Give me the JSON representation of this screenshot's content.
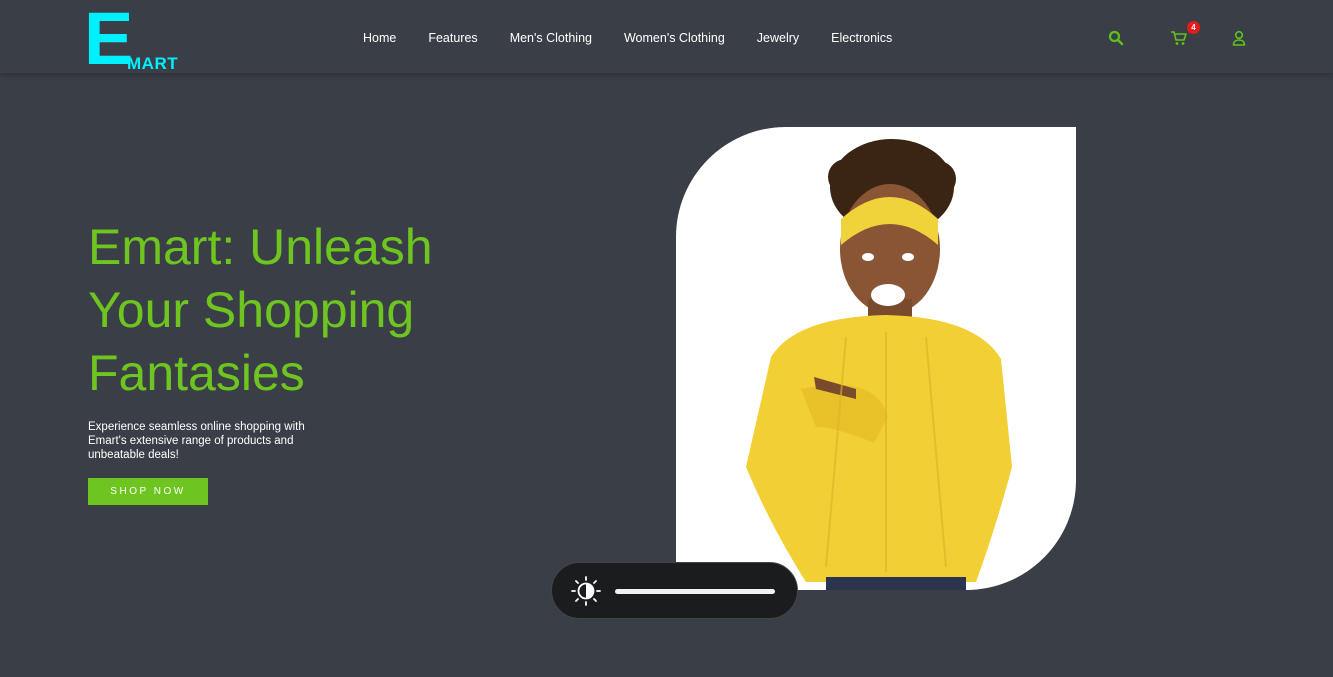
{
  "brand": {
    "logo_letter": "E",
    "logo_word": "MART",
    "logo_color": "#00f0ff"
  },
  "nav": {
    "items": [
      {
        "label": "Home",
        "name": "nav-home"
      },
      {
        "label": "Features",
        "name": "nav-features"
      },
      {
        "label": "Men's Clothing",
        "name": "nav-mens-clothing"
      },
      {
        "label": "Women's Clothing",
        "name": "nav-womens-clothing"
      },
      {
        "label": "Jewelry",
        "name": "nav-jewelry"
      },
      {
        "label": "Electronics",
        "name": "nav-electronics"
      }
    ]
  },
  "header_icons": {
    "search": "search-icon",
    "cart": "cart-icon",
    "user": "user-icon",
    "cart_count": "4"
  },
  "hero": {
    "title": "Emart: Unleash Your Shopping Fantasies",
    "subtitle": "Experience seamless online shopping with Emart's extensive range of products and unbeatable deals!",
    "cta_label": "SHOP NOW",
    "image": "woman-yellow-sweater-pointing"
  },
  "brightness": {
    "icon": "brightness-icon",
    "level": 1.0
  },
  "colors": {
    "accent": "#6ec51f",
    "background": "#3a3f47",
    "badge": "#e61b1b"
  }
}
